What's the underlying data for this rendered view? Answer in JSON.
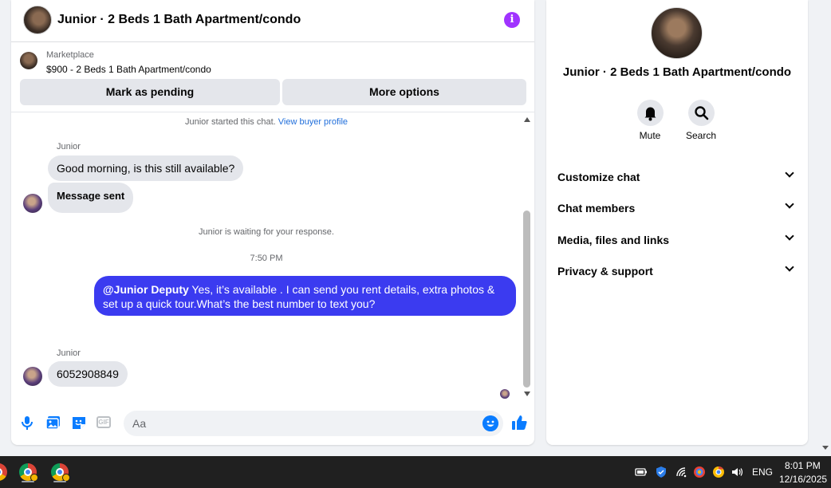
{
  "chat": {
    "title": "Junior · 2 Beds 1 Bath Apartment/condo",
    "marketplace_label": "Marketplace",
    "listing_price_title": "$900 - 2 Beds 1 Bath Apartment/condo",
    "mark_pending_label": "Mark as pending",
    "more_options_label": "More options",
    "started_text": "Junior started this chat.",
    "view_profile_link": "View buyer profile",
    "messages": [
      {
        "sender": "Junior",
        "text": "Good morning, is this still available?"
      },
      {
        "text": "Message sent"
      }
    ],
    "waiting_text": "Junior is waiting for your response.",
    "timestamp": "7:50 PM",
    "outgoing": {
      "mention": "@Junior Deputy",
      "text": " Yes, it’s available .  I can send you rent details, extra photos & set up a quick tour.What’s the best number to text you?"
    },
    "reply": {
      "sender": "Junior",
      "text": "6052908849"
    },
    "composer_placeholder": "Aa",
    "gif_label": "GIF",
    "colors": {
      "outgoing_bubble": "#3b3bf0",
      "accent": "#0a7cff",
      "info": "#a033ff"
    }
  },
  "details": {
    "title": "Junior · 2 Beds 1 Bath Apartment/condo",
    "actions": [
      {
        "label": "Mute",
        "icon": "bell-icon"
      },
      {
        "label": "Search",
        "icon": "search-icon"
      }
    ],
    "sections": [
      {
        "label": "Customize chat"
      },
      {
        "label": "Chat members"
      },
      {
        "label": "Media, files and links"
      },
      {
        "label": "Privacy & support"
      }
    ]
  },
  "taskbar": {
    "language": "ENG",
    "time": "8:01 PM",
    "date": "12/16/2025"
  }
}
